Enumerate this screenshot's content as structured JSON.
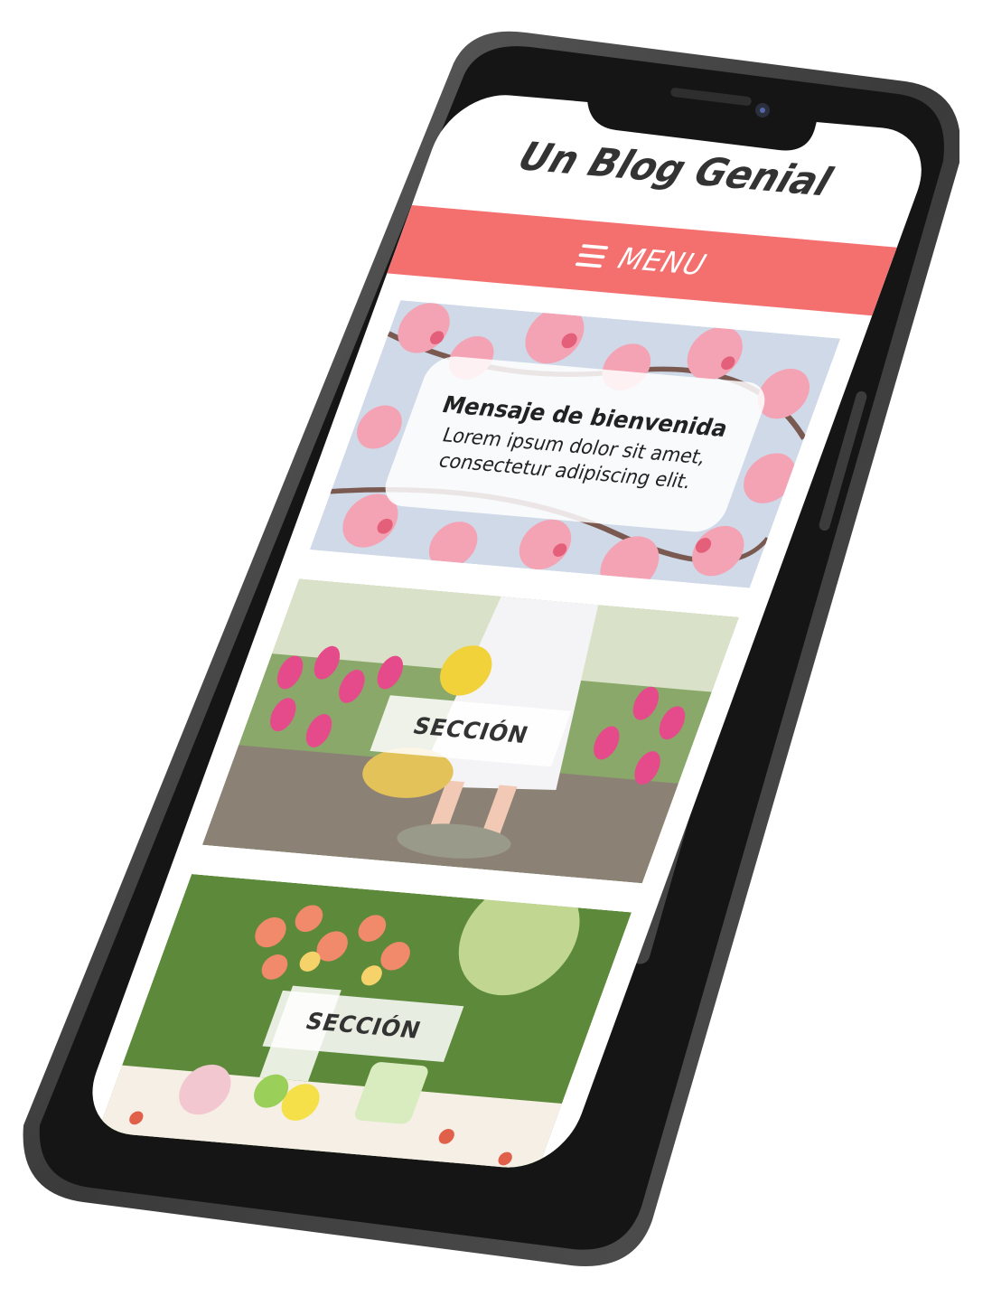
{
  "header": {
    "title": "Un Blog Genial"
  },
  "nav": {
    "menu_label": "MENU",
    "icon": "hamburger-icon",
    "color": "#f4706f"
  },
  "hero": {
    "title": "Mensaje de bienvenida",
    "text": "Lorem ipsum dolor sit amet, consectetur adipiscing elit."
  },
  "sections": [
    {
      "label": "SECCIÓN"
    },
    {
      "label": "SECCIÓN"
    }
  ],
  "colors": {
    "accent": "#f4706f",
    "text": "#333333",
    "frame": "#2b2b2b"
  }
}
